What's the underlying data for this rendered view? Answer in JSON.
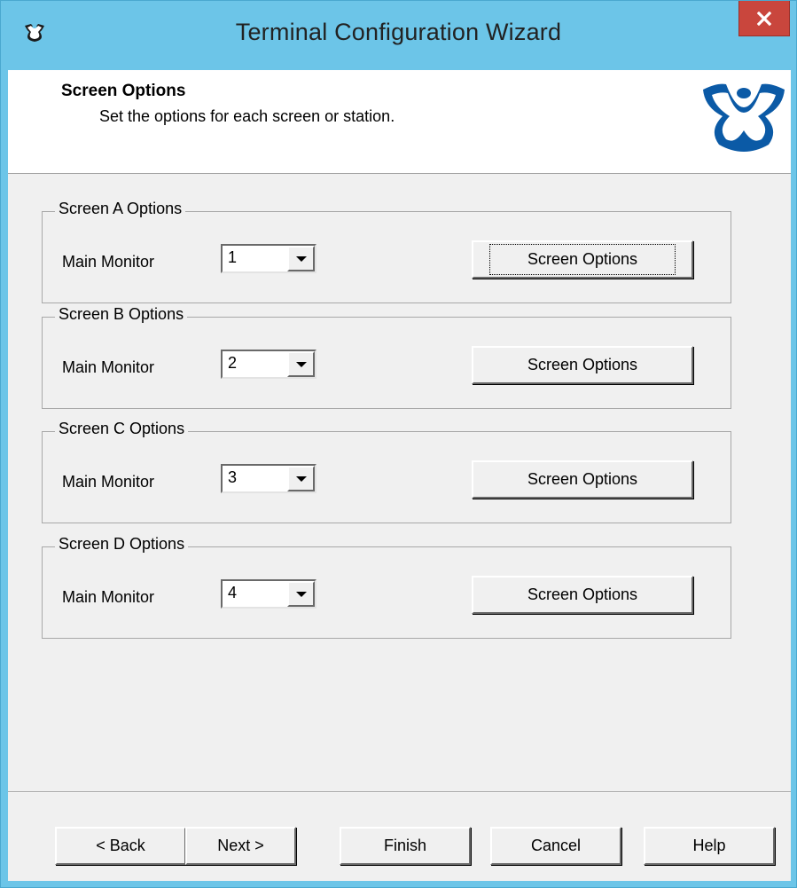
{
  "window": {
    "title": "Terminal Configuration Wizard",
    "close_label": "x"
  },
  "header": {
    "title": "Screen Options",
    "subtitle": "Set the options for each screen or station."
  },
  "groups": [
    {
      "label": "Screen A Options",
      "monitor_label": "Main Monitor",
      "monitor_value": "1",
      "button_label": "Screen Options",
      "focused": true
    },
    {
      "label": "Screen B Options",
      "monitor_label": "Main Monitor",
      "monitor_value": "2",
      "button_label": "Screen Options",
      "focused": false
    },
    {
      "label": "Screen C Options",
      "monitor_label": "Main Monitor",
      "monitor_value": "3",
      "button_label": "Screen Options",
      "focused": false
    },
    {
      "label": "Screen D Options",
      "monitor_label": "Main Monitor",
      "monitor_value": "4",
      "button_label": "Screen Options",
      "focused": false
    }
  ],
  "footer": {
    "back_label": "< Back",
    "next_label": "Next >",
    "finish_label": "Finish",
    "cancel_label": "Cancel",
    "help_label": "Help"
  },
  "colors": {
    "frame": "#6cc5e8",
    "close_button": "#c9463d",
    "logo_blue": "#0b5aa6",
    "dialog_bg": "#f0f0f0"
  },
  "icons": {
    "title": "app-logo-icon",
    "close": "close-icon",
    "header_logo": "thinmanager-logo-icon",
    "dropdown": "chevron-down-icon"
  }
}
